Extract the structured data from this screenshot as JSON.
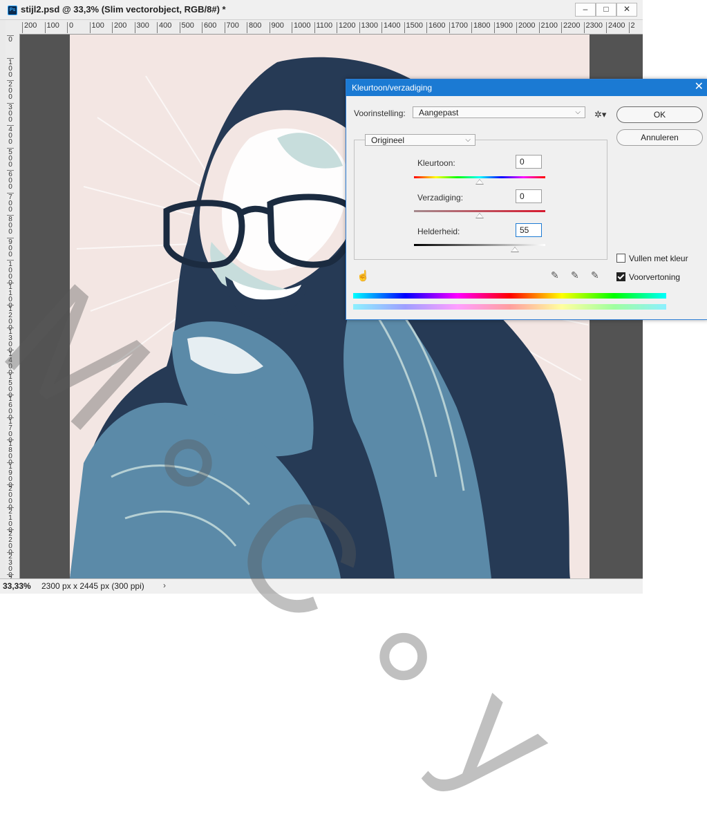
{
  "window": {
    "title": "stijl2.psd @ 33,3% (Slim vectorobject, RGB/8#) *",
    "app_icon": "Ps",
    "minimize": "–",
    "maximize": "□",
    "close": "✕"
  },
  "ruler": {
    "horizontal": [
      "200",
      "100",
      "0",
      "100",
      "200",
      "300",
      "400",
      "500",
      "600",
      "700",
      "800",
      "900",
      "1000",
      "1100",
      "1200",
      "1300",
      "1400",
      "1500",
      "1600",
      "1700",
      "1800",
      "1900",
      "2000",
      "2100",
      "2200",
      "2300",
      "2400",
      "2"
    ],
    "vertical": [
      "0",
      "100",
      "200",
      "300",
      "400",
      "500",
      "600",
      "700",
      "800",
      "900",
      "1000",
      "1100",
      "1200",
      "1300",
      "1400",
      "1500",
      "1600",
      "1700",
      "1800",
      "1900",
      "2000",
      "2100",
      "2200",
      "2300",
      "2"
    ]
  },
  "status": {
    "zoom": "33,33%",
    "doc_info": "2300 px x 2445 px (300 ppi)",
    "arrow": "›"
  },
  "dialog": {
    "title": "Kleurtoon/verzadiging",
    "close": "✕",
    "preset_label": "Voorinstelling:",
    "preset_value": "Aangepast",
    "channel_value": "Origineel",
    "ok": "OK",
    "cancel": "Annuleren",
    "hue": {
      "label": "Kleurtoon:",
      "value": "0",
      "position": 0.5
    },
    "saturation": {
      "label": "Verzadiging:",
      "value": "0",
      "position": 0.5
    },
    "lightness": {
      "label": "Helderheid:",
      "value": "55",
      "position": 0.77
    },
    "colorize": {
      "label": "Vullen met kleur",
      "checked": false
    },
    "preview": {
      "label": "Voorvertoning",
      "checked": true
    }
  },
  "watermark": {
    "text": "M ∘ C ∘ y"
  },
  "colors": {
    "dialog_title_bg": "#1b7ad3",
    "canvas_bg": "#f3e6e3",
    "pasteboard": "#535353",
    "navy": "#263a55",
    "steel_blue": "#5b8aa8",
    "pale_teal": "#c7dddc"
  },
  "icons": [
    "photoshop-icon",
    "gear-icon",
    "chevron-down-icon",
    "hand-adjust-icon",
    "eyedropper-icon",
    "eyedropper-plus-icon",
    "eyedropper-minus-icon"
  ]
}
